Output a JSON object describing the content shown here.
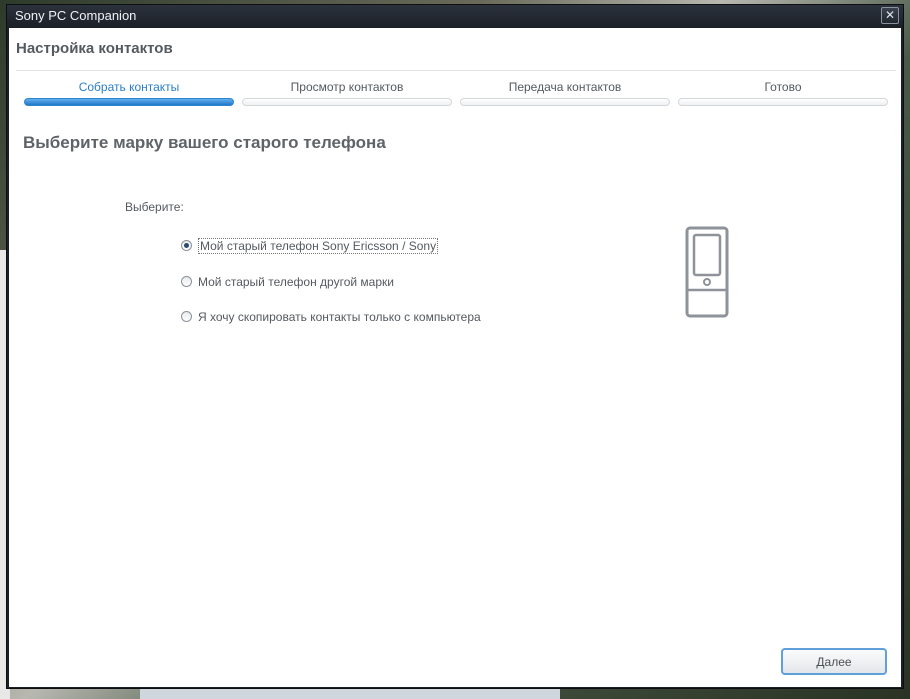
{
  "window": {
    "title": "Sony PC Companion",
    "close_glyph": "✕"
  },
  "header": {
    "title": "Настройка контактов"
  },
  "steps": [
    {
      "label": "Собрать контакты",
      "active": true
    },
    {
      "label": "Просмотр контактов",
      "active": false
    },
    {
      "label": "Передача контактов",
      "active": false
    },
    {
      "label": "Готово",
      "active": false
    }
  ],
  "main": {
    "section_title": "Выберите марку вашего старого телефона",
    "choose_label": "Выберите:",
    "options": [
      {
        "label": "Мой старый телефон Sony Ericsson / Sony",
        "checked": true
      },
      {
        "label": "Мой старый телефон другой марки",
        "checked": false
      },
      {
        "label": "Я хочу скопировать контакты только с компьютера",
        "checked": false
      }
    ],
    "icon": "phone-icon"
  },
  "footer": {
    "next_label": "Далее"
  },
  "colors": {
    "accent": "#2b7fc7",
    "title_bar": "#1f232b",
    "text": "#555a60"
  }
}
